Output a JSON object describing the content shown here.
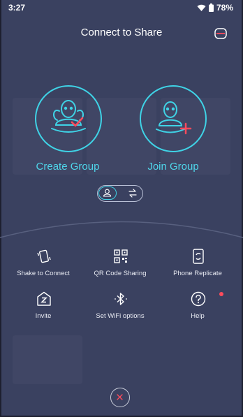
{
  "status": {
    "time": "3:27",
    "battery": "78%"
  },
  "header": {
    "title": "Connect to Share"
  },
  "main": {
    "create_label": "Create Group",
    "join_label": "Join Group"
  },
  "options": [
    {
      "label": "Shake to Connect",
      "icon": "shake-phone-icon"
    },
    {
      "label": "QR Code Sharing",
      "icon": "qr-code-icon"
    },
    {
      "label": "Phone Replicate",
      "icon": "phone-replicate-icon"
    },
    {
      "label": "Invite",
      "icon": "invite-icon"
    },
    {
      "label": "Set WiFi options",
      "icon": "bluetooth-icon"
    },
    {
      "label": "Help",
      "icon": "help-icon"
    }
  ],
  "colors": {
    "accent": "#3fd3e6",
    "background": "#3a4160",
    "alert": "#ff4b5c"
  }
}
